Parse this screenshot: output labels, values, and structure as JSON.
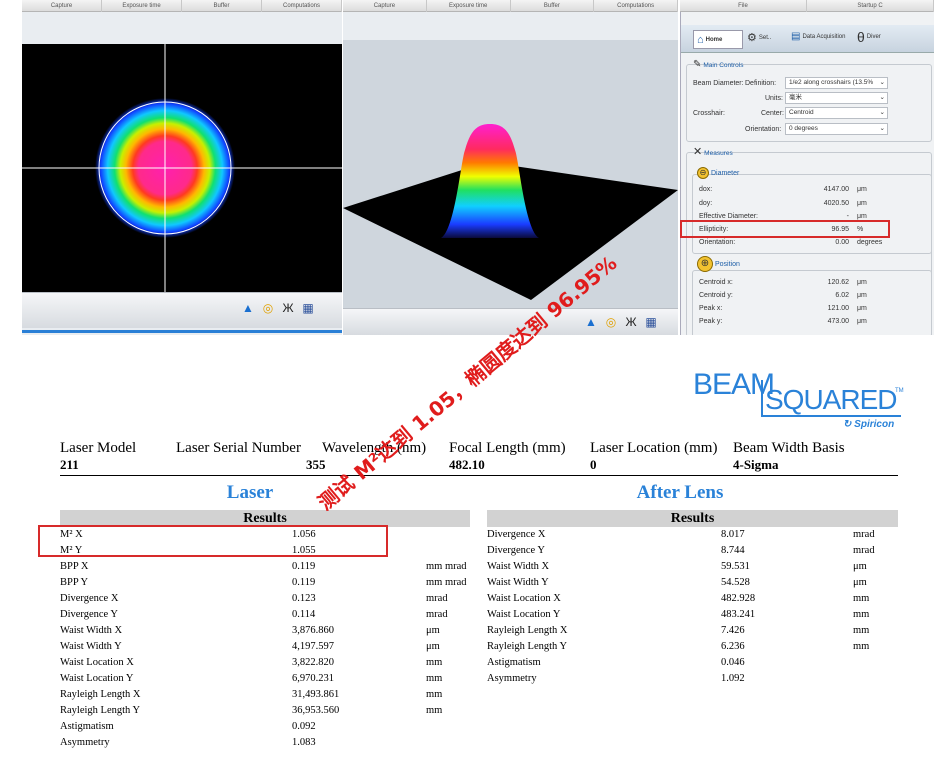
{
  "top_tabs_left": [
    "Capture",
    "Exposure time",
    "Buffer",
    "Computations"
  ],
  "top_tabs_mid": [
    "Capture",
    "Exposure time",
    "Buffer",
    "Computations"
  ],
  "top_tabs_right": [
    "File",
    "Startup C"
  ],
  "side_tabs": [
    "Home",
    "Set..",
    "Data Acquisition",
    "Diver"
  ],
  "main_controls": {
    "title": "Main Controls",
    "beam_diameter_label": "Beam Diameter:",
    "definition_label": "Definition:",
    "definition_value": "1/e2 along crosshairs (13.5%",
    "units_label": "Units:",
    "units_value": "毫米",
    "crosshair_label": "Crosshair:",
    "center_label": "Center:",
    "center_value": "Centroid",
    "orientation_label": "Orientation:",
    "orientation_value": "0 degrees"
  },
  "measures": {
    "title": "Measures",
    "diameter_title": "Diameter",
    "rows": [
      {
        "label": "dox:",
        "value": "4147.00",
        "unit": "μm"
      },
      {
        "label": "doy:",
        "value": "4020.50",
        "unit": "μm"
      },
      {
        "label": "Effective Diameter:",
        "value": "-",
        "unit": "μm"
      },
      {
        "label": "Ellipticity:",
        "value": "96.95",
        "unit": "%"
      },
      {
        "label": "Orientation:",
        "value": "0.00",
        "unit": "degrees"
      }
    ],
    "position_title": "Position",
    "pos_rows": [
      {
        "label": "Centroid x:",
        "value": "120.62",
        "unit": "μm"
      },
      {
        "label": "Centroid y:",
        "value": "6.02",
        "unit": "μm"
      },
      {
        "label": "Peak x:",
        "value": "121.00",
        "unit": "μm"
      },
      {
        "label": "Peak y:",
        "value": "473.00",
        "unit": "μm"
      }
    ]
  },
  "watermark": "测试 M²达到 1.05，椭圆度达到 96.95%",
  "brand": {
    "beam": "BEAM",
    "squared": "SQUARED",
    "tm": "TM",
    "spiricon": "Spiricon"
  },
  "header": {
    "labels": [
      "Laser Model",
      "Laser Serial Number",
      "Wavelength (nm)",
      "Focal Length (mm)",
      "Laser Location (mm)",
      "Beam Width Basis"
    ],
    "values": [
      "211",
      "",
      "355",
      "482.10",
      "0",
      "4-Sigma"
    ]
  },
  "laser": {
    "title": "Laser",
    "results": "Results",
    "rows": [
      {
        "name": "M² X",
        "value": "1.056",
        "unit": ""
      },
      {
        "name": "M² Y",
        "value": "1.055",
        "unit": ""
      },
      {
        "name": "BPP X",
        "value": "0.119",
        "unit": "mm mrad"
      },
      {
        "name": "BPP Y",
        "value": "0.119",
        "unit": "mm mrad"
      },
      {
        "name": "Divergence X",
        "value": "0.123",
        "unit": "mrad"
      },
      {
        "name": "Divergence Y",
        "value": "0.114",
        "unit": "mrad"
      },
      {
        "name": "Waist Width X",
        "value": "3,876.860",
        "unit": "μm"
      },
      {
        "name": "Waist Width Y",
        "value": "4,197.597",
        "unit": "μm"
      },
      {
        "name": "Waist Location X",
        "value": "3,822.820",
        "unit": "mm"
      },
      {
        "name": "Waist Location Y",
        "value": "6,970.231",
        "unit": "mm"
      },
      {
        "name": "Rayleigh Length X",
        "value": "31,493.861",
        "unit": "mm"
      },
      {
        "name": "Rayleigh Length Y",
        "value": "36,953.560",
        "unit": "mm"
      },
      {
        "name": "Astigmatism",
        "value": "0.092",
        "unit": ""
      },
      {
        "name": "Asymmetry",
        "value": "1.083",
        "unit": ""
      }
    ]
  },
  "after": {
    "title": "After Lens",
    "results": "Results",
    "rows": [
      {
        "name": "Divergence X",
        "value": "8.017",
        "unit": "mrad"
      },
      {
        "name": "Divergence Y",
        "value": "8.744",
        "unit": "mrad"
      },
      {
        "name": "Waist Width X",
        "value": "59.531",
        "unit": "μm"
      },
      {
        "name": "Waist Width Y",
        "value": "54.528",
        "unit": "μm"
      },
      {
        "name": "Waist Location X",
        "value": "482.928",
        "unit": "mm"
      },
      {
        "name": "Waist Location Y",
        "value": "483.241",
        "unit": "mm"
      },
      {
        "name": "Rayleigh Length X",
        "value": "7.426",
        "unit": "mm"
      },
      {
        "name": "Rayleigh Length Y",
        "value": "6.236",
        "unit": "mm"
      },
      {
        "name": "Astigmatism",
        "value": "0.046",
        "unit": ""
      },
      {
        "name": "Asymmetry",
        "value": "1.092",
        "unit": ""
      }
    ]
  },
  "colors": {
    "accent": "#2a82d8",
    "highlight": "#d72a2a"
  }
}
